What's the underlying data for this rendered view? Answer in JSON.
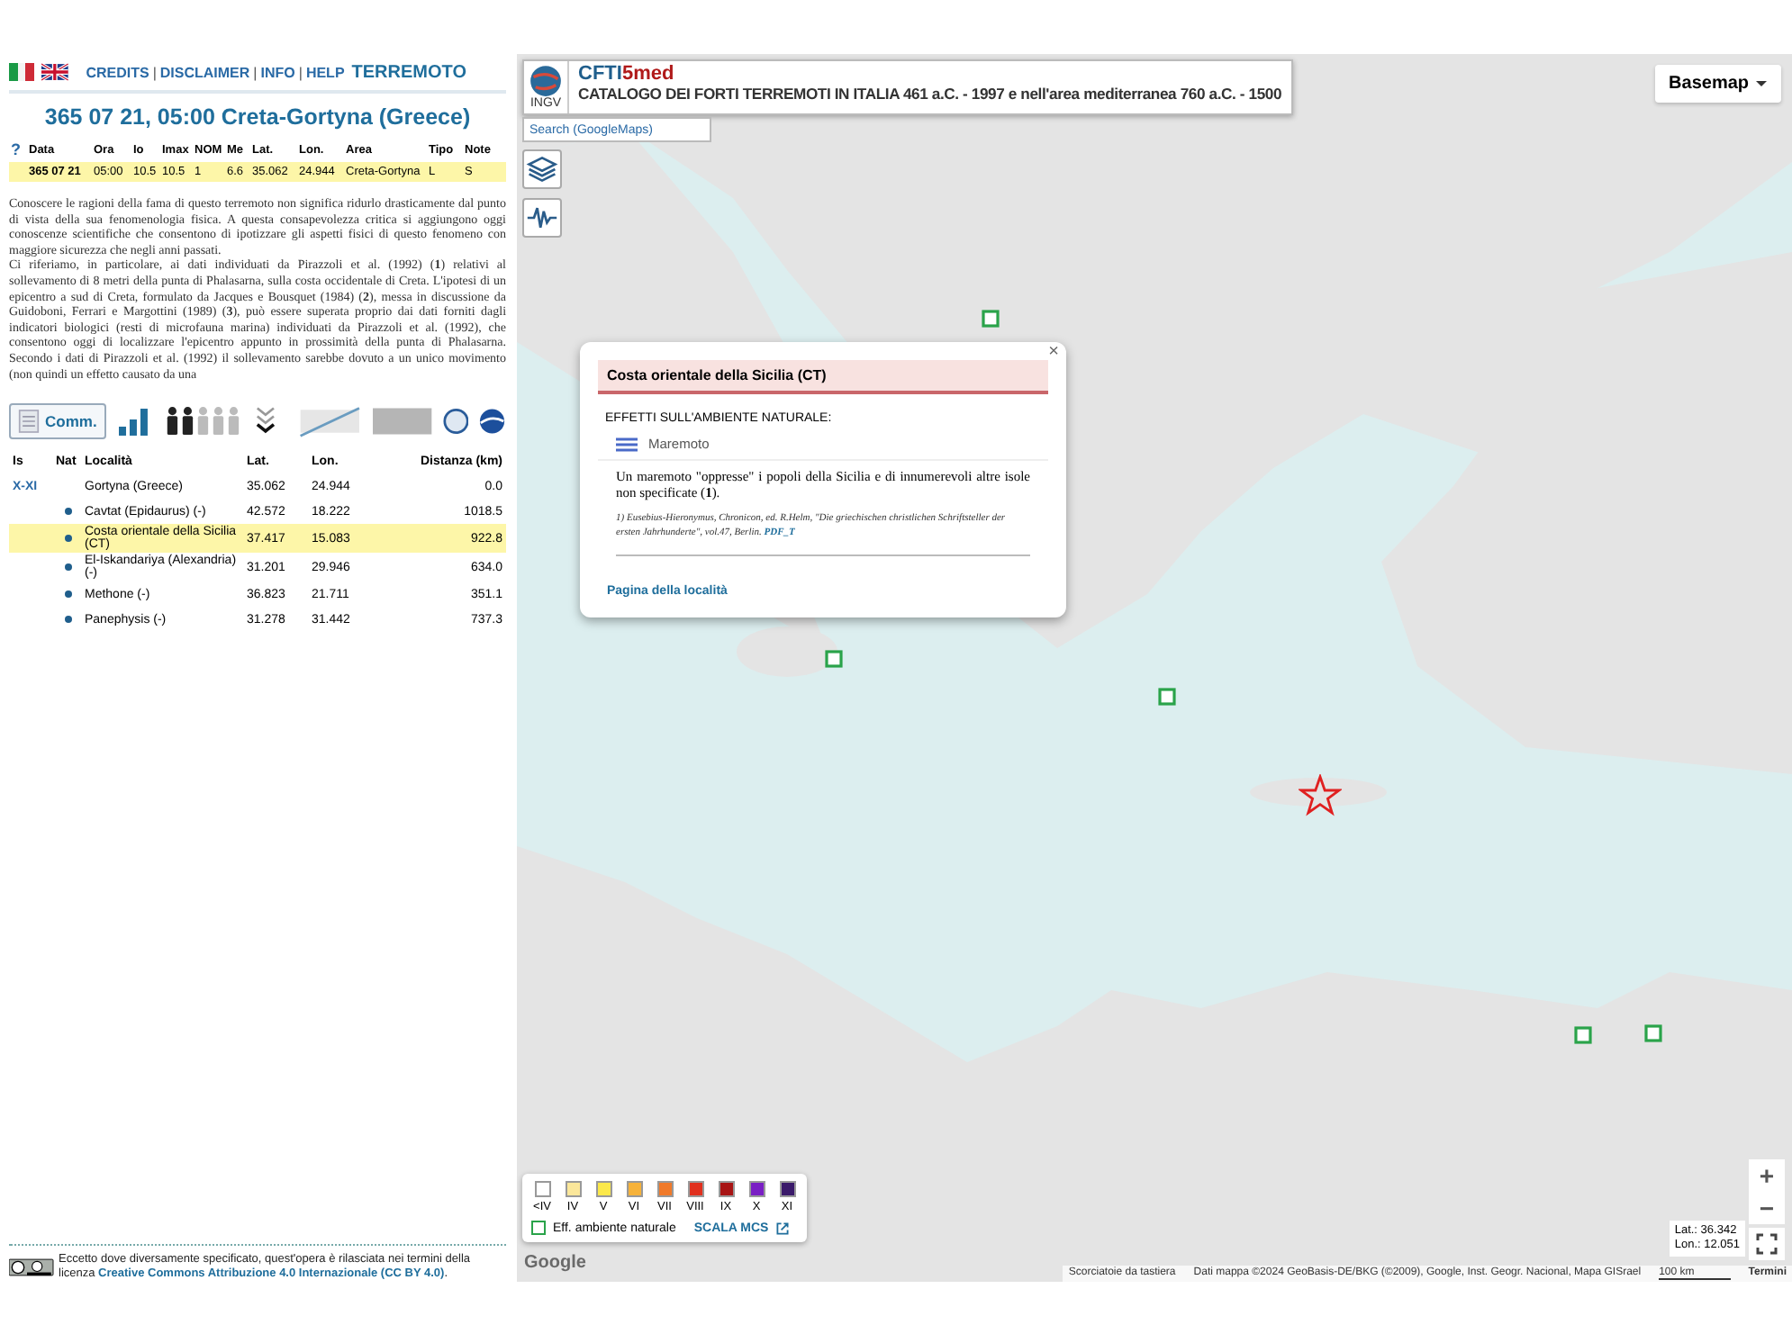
{
  "top_bar": {
    "links": [
      "CREDITS",
      "DISCLAIMER",
      "INFO",
      "HELP"
    ],
    "separator": "|",
    "section": "TERREMOTO"
  },
  "event_title": "365 07 21, 05:00 Creta-Gortyna (Greece)",
  "event_table": {
    "help": "?",
    "columns": [
      "Data",
      "Ora",
      "Io",
      "Imax",
      "NOM",
      "Me",
      "Lat.",
      "Lon.",
      "Area",
      "Tipo",
      "Note"
    ],
    "rows": [
      {
        "cells": [
          "365 07 21",
          "05:00",
          "10.5",
          "10.5",
          "1",
          "6.6",
          "35.062",
          "24.944",
          "Creta-Gortyna",
          "L",
          "S"
        ],
        "selected": true
      }
    ]
  },
  "description": [
    "Conoscere le ragioni della fama di questo terremoto non significa ridurlo drasticamente dal punto di vista della sua fenomenologia fisica. A questa consapevolezza critica si aggiungono oggi conoscenze scientifiche che consentono di ipotizzare gli aspetti fisici di questo fenomeno con maggiore sicurezza che negli anni passati.",
    "Ci riferiamo, in particolare, ai dati individuati da Pirazzoli et al. (1992) (**1**) relativi al sollevamento di 8 metri della punta di Phalasarna, sulla costa occidentale di Creta. L'ipotesi di un epicentro a sud di Creta, formulato da Jacques e Bousquet (1984) (**2**), messa in discussione da Guidoboni, Ferrari e Margottini (1989) (**3**), può essere superata proprio dai dati forniti dagli indicatori biologici (resti di microfauna marina) individuati da Pirazzoli et al. (1992), che consentono oggi di localizzare l'epicentro appunto in prossimità della punta di Phalasarna. Secondo i dati di Pirazzoli et al. (1992) il sollevamento sarebbe dovuto a un unico movimento (non quindi un effetto causato da una"
  ],
  "toolbar": {
    "comment_button": "Comm."
  },
  "localities": {
    "columns": [
      "Is",
      "Nat",
      "Località",
      "Lat.",
      "Lon.",
      "Distanza (km)"
    ],
    "rows": [
      {
        "is": "X-XI",
        "nat": false,
        "place": "Gortyna (Greece)",
        "lat": "35.062",
        "lon": "24.944",
        "distance": "0.0",
        "selected": false
      },
      {
        "nat": true,
        "place": "Cavtat (Epidaurus) (-)",
        "lat": "42.572",
        "lon": "18.222",
        "distance": "1018.5",
        "selected": false
      },
      {
        "nat": true,
        "place": "Costa orientale della Sicilia (CT)",
        "lat": "37.417",
        "lon": "15.083",
        "distance": "922.8",
        "selected": true
      },
      {
        "nat": true,
        "place": "El-Iskandariya (Alexandria) (-)",
        "lat": "31.201",
        "lon": "29.946",
        "distance": "634.0",
        "selected": false
      },
      {
        "nat": true,
        "place": "Methone (-)",
        "lat": "36.823",
        "lon": "21.711",
        "distance": "351.1",
        "selected": false
      },
      {
        "nat": true,
        "place": "Panephysis (-)",
        "lat": "31.278",
        "lon": "31.442",
        "distance": "737.3",
        "selected": false
      }
    ]
  },
  "license": {
    "text": "Eccetto dove diversamente specificato, quest'opera è rilasciata nei termini della licenza",
    "link": "Creative Commons Attribuzione 4.0 Internazionale (CC BY 4.0)",
    "suffix": "."
  },
  "map": {
    "header": {
      "logo_label": "INGV",
      "name": "CFTI",
      "name_suffix": "5med",
      "subtitle": "CATALOGO DEI FORTI TERREMOTI IN ITALIA 461 a.C. - 1997 e nell'area mediterranea 760 a.C. - 1500"
    },
    "search": {
      "placeholder": "Search (GoogleMaps)"
    },
    "basemap_button": "Basemap",
    "popup": {
      "close": "×",
      "title": "Costa orientale della Sicilia (CT)",
      "section": "EFFETTI SULL'AMBIENTE NATURALE:",
      "effect": "Maremoto",
      "text": "Un maremoto \"oppresse\" i popoli della Sicilia e di innumerevoli altre isole non specificate (**1**).",
      "reference": "1) Eusebius-Hieronymus, Chronicon, ed. R.Helm, \"Die griechischen christlichen Schriftsteller der ersten Jahrhunderte\", vol.47, Berlin.",
      "reference_link": "PDF_T",
      "page_link": "Pagina della località"
    },
    "legend": {
      "classes": [
        {
          "label": "<IV",
          "color": "#ffffff"
        },
        {
          "label": "IV",
          "color": "#fbe79a"
        },
        {
          "label": "V",
          "color": "#fbe84a"
        },
        {
          "label": "VI",
          "color": "#f6b23a"
        },
        {
          "label": "VII",
          "color": "#f07a2a"
        },
        {
          "label": "VIII",
          "color": "#e0301e"
        },
        {
          "label": "IX",
          "color": "#a81414"
        },
        {
          "label": "X",
          "color": "#7a1fc4"
        },
        {
          "label": "XI",
          "color": "#3a1a6a"
        }
      ],
      "environment": "Eff. ambiente naturale",
      "scale_link": "SCALA MCS"
    },
    "zoom_in": "+",
    "zoom_out": "−",
    "lat": "Lat.: 36.342",
    "lon": "Lon.: 12.051",
    "google": "Google",
    "attribution": {
      "shortcuts": "Scorciatoie da tastiera",
      "data": "Dati mappa ©2024 GeoBasis-DE/BKG (©2009), Google, Inst. Geogr. Nacional, Mapa GISrael",
      "scale": "100 km",
      "terms": "Termini"
    }
  }
}
